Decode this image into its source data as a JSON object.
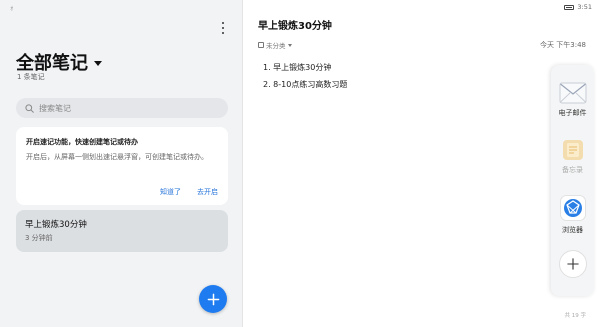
{
  "status_bar": {
    "left_icon": "android-status-icon",
    "time": "3:51"
  },
  "notes_list": {
    "title": "全部笔记",
    "count_text": "1 条笔记",
    "search_placeholder": "搜索笔记",
    "tip_card": {
      "title": "开启速记功能，快速创建笔记或待办",
      "body": "开启后，从屏幕一侧划出速记悬浮窗，可创建笔记或待办。",
      "dismiss_label": "知道了",
      "enable_label": "去开启"
    },
    "notes": [
      {
        "title": "早上锻炼30分钟",
        "time": "3 分钟前"
      }
    ]
  },
  "editor": {
    "title": "早上锻炼30分钟",
    "category": "未分类",
    "datetime": "今天 下午3:48",
    "lines": [
      "1. 早上锻炼30分钟",
      "2. 8-10点练习高数习题"
    ],
    "word_count": "共 19 字"
  },
  "dock": {
    "items": [
      {
        "label": "电子邮件",
        "icon": "email-icon",
        "enabled": true
      },
      {
        "label": "备忘录",
        "icon": "memo-icon",
        "enabled": false
      },
      {
        "label": "浏览器",
        "icon": "browser-icon",
        "enabled": true
      }
    ]
  },
  "colors": {
    "accent": "#1f7cf0",
    "link": "#2573d9",
    "panel_bg": "#f1f3f5"
  }
}
